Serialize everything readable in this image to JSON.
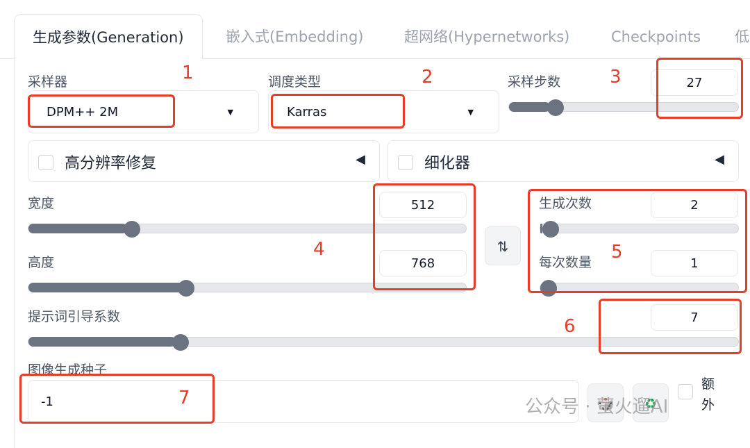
{
  "tabs": [
    {
      "label": "生成参数(Generation)",
      "active": true
    },
    {
      "label": "嵌入式(Embedding)"
    },
    {
      "label": "超网络(Hypernetworks)"
    },
    {
      "label": "Checkpoints"
    },
    {
      "label": "低"
    }
  ],
  "sampler": {
    "label": "采样器",
    "value": "DPM++ 2M"
  },
  "scheduler": {
    "label": "调度类型",
    "value": "Karras"
  },
  "steps": {
    "label": "采样步数",
    "value": "27",
    "fraction": 0.18
  },
  "hires": {
    "label": "高分辨率修复",
    "checked": false
  },
  "refiner": {
    "label": "细化器",
    "checked": false
  },
  "width": {
    "label": "宽度",
    "value": "512",
    "fraction": 0.226
  },
  "height": {
    "label": "高度",
    "value": "768",
    "fraction": 0.355
  },
  "swap_icon": "swap-vertical-icon",
  "batch_count": {
    "label": "生成次数",
    "value": "2",
    "fraction": 0.01
  },
  "batch_size": {
    "label": "每次数量",
    "value": "1",
    "fraction": 0
  },
  "cfg": {
    "label": "提示词引导系数",
    "value": "7",
    "fraction": 0.207
  },
  "seed": {
    "label": "图像生成种子",
    "value": "-1",
    "extra_label": "额外"
  },
  "annotations": [
    "1",
    "2",
    "3",
    "4",
    "5",
    "6",
    "7"
  ],
  "watermark": "公众号 · 萤火遛AI",
  "colors": {
    "annotation": "#e53d2a",
    "slider": "#6b7280"
  }
}
